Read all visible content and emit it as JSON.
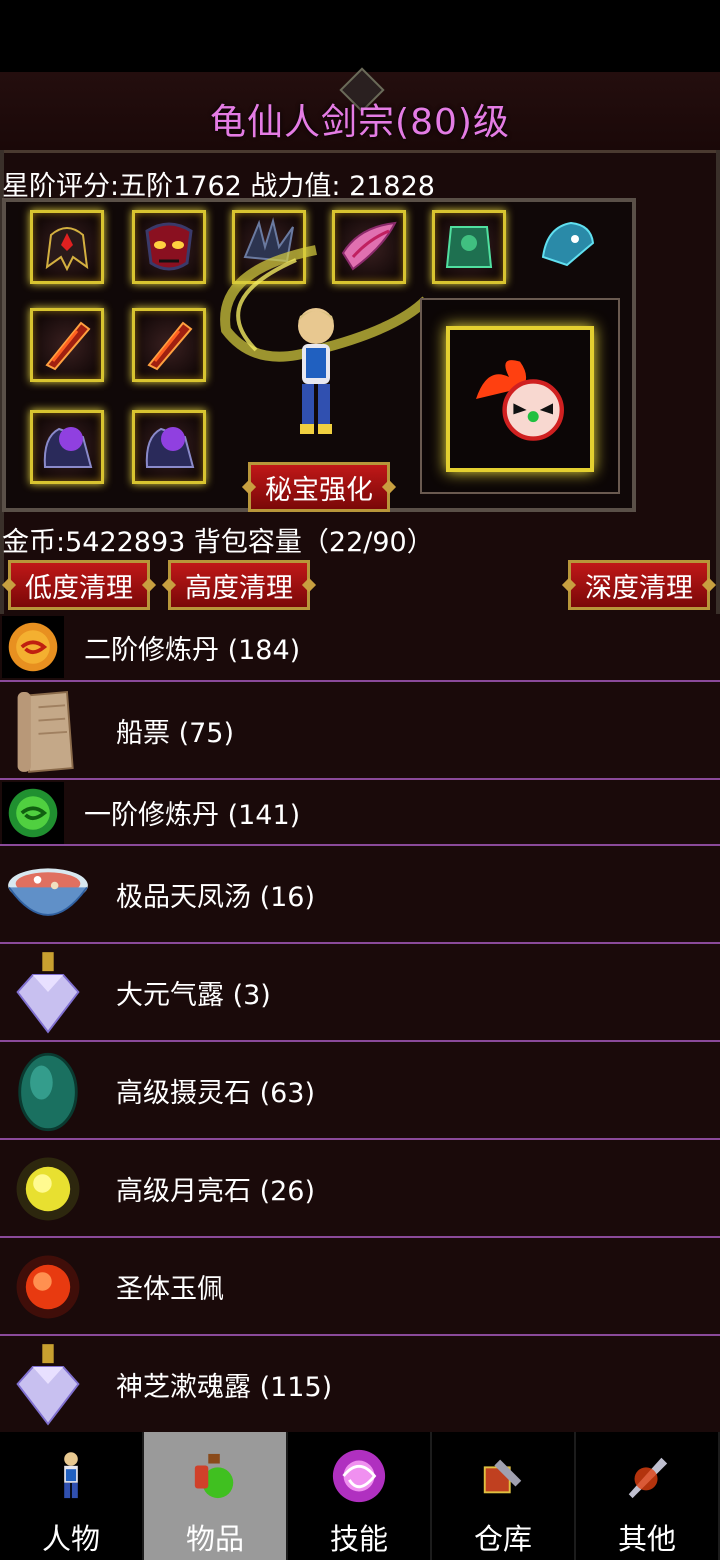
{
  "header": {
    "title": "龟仙人剑宗(80)级",
    "rating": "星阶评分:五阶1762 战力值:  21828"
  },
  "equipment": {
    "slots": [
      {
        "icon": "helmet-icon",
        "color": "#c02020"
      },
      {
        "icon": "demon-mask-icon",
        "color": "#a01818"
      },
      {
        "icon": "dark-wing-icon",
        "color": "#2a3048"
      },
      {
        "icon": "pink-bracer-icon",
        "color": "#e060a0"
      },
      {
        "icon": "jade-armor-icon",
        "color": "#30a060"
      },
      {
        "icon": "dragon-head-icon",
        "color": "#3090b0"
      },
      {
        "icon": "flame-blade-icon",
        "color": "#c04010"
      },
      {
        "icon": "flame-blade-icon",
        "color": "#c04010"
      },
      {
        "icon": "purple-orb-boots-icon",
        "color": "#7040c0"
      },
      {
        "icon": "purple-orb-boots-icon",
        "color": "#7040c0"
      }
    ],
    "treasure_button": "秘宝强化",
    "pet_icon": "fire-spirit-pet-icon"
  },
  "inventory": {
    "gold_capacity": "金币:5422893 背包容量（22/90）",
    "buttons": {
      "low_clean": "低度清理",
      "high_clean": "高度清理",
      "deep_clean": "深度清理"
    },
    "items": [
      {
        "name": "二阶修炼丹 (184)",
        "icon": "orange-pill-icon"
      },
      {
        "name": "船票 (75)",
        "icon": "scroll-ticket-icon"
      },
      {
        "name": "一阶修炼丹 (141)",
        "icon": "green-pill-icon"
      },
      {
        "name": "极品天凤汤 (16)",
        "icon": "soup-bowl-icon"
      },
      {
        "name": "大元气露 (3)",
        "icon": "crystal-flask-icon"
      },
      {
        "name": "高级摄灵石 (63)",
        "icon": "teal-stone-icon"
      },
      {
        "name": "高级月亮石 (26)",
        "icon": "moonstone-icon"
      },
      {
        "name": "圣体玉佩",
        "icon": "red-orb-icon"
      },
      {
        "name": "神芝漱魂露 (115)",
        "icon": "crystal-flask-icon"
      }
    ]
  },
  "tabs": [
    {
      "label": "人物",
      "icon": "character-icon",
      "active": false
    },
    {
      "label": "物品",
      "icon": "potion-icon",
      "active": true
    },
    {
      "label": "技能",
      "icon": "skill-orb-icon",
      "active": false
    },
    {
      "label": "仓库",
      "icon": "warehouse-icon",
      "active": false
    },
    {
      "label": "其他",
      "icon": "sword-other-icon",
      "active": false
    }
  ]
}
